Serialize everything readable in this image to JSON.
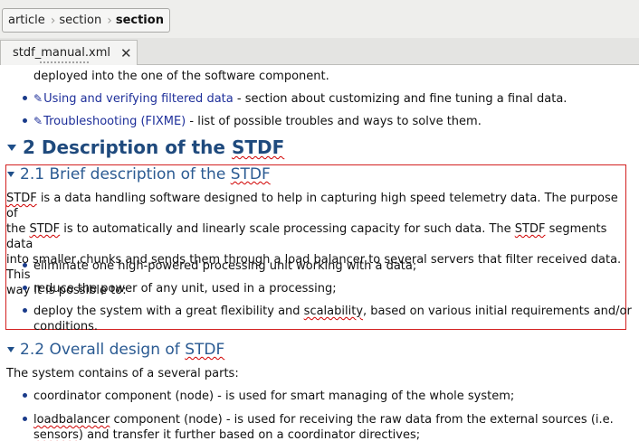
{
  "breadcrumb": [
    "article",
    "section",
    "section"
  ],
  "tab": {
    "label": "stdf_manual.xml",
    "close": "✕"
  },
  "content": {
    "top_line": "deployed into the one of the software component.",
    "toc_items": [
      {
        "link": "Using and verifying filtered data",
        "rest": " - section about customizing and fine tuning a final data."
      },
      {
        "link": "Troubleshooting (FIXME)",
        "rest": " - list of possible troubles and ways to solve them."
      }
    ],
    "heading2": {
      "prefix": "2 Description of the ",
      "term": "STDF"
    },
    "section_2_1": {
      "title_prefix": "2.1 Brief description of the ",
      "title_term": "STDF",
      "para": {
        "s1": "STDF",
        "s2": " is a data handling software designed to help in capturing high speed telemetry data. The purpose of",
        "s3": "the ",
        "s4": "STDF",
        "s5": " is to automatically and linearly scale processing capacity for such data. The ",
        "s6": "STDF",
        "s7": " segments data",
        "s8": "into smaller chunks and sends them through a load balancer to several servers that filter received data. This",
        "s9": "way it is possible to:"
      },
      "bullets": [
        "eliminate one high-powered processing unit working with a data;",
        "reduce the power of any unit, used in a processing;"
      ],
      "bullet3": {
        "a": "deploy the system with a great flexibility and ",
        "b": "scalability",
        "c": ", based on various initial requirements and/or",
        "d": "conditions."
      }
    },
    "section_2_2": {
      "title_prefix": "2.2 Overall design of ",
      "title_term": "STDF",
      "intro": "The system contains of a several parts:",
      "bullet1": "coordinator component (node) - is used for smart managing of the whole system;",
      "bullet2": {
        "a": "loadbalancer",
        "b": " component (node) - is used for receiving the raw data from the external sources (i.e.",
        "c": "sensors",
        "d": ") and transfer it further based on a coordinator directives;"
      }
    }
  }
}
